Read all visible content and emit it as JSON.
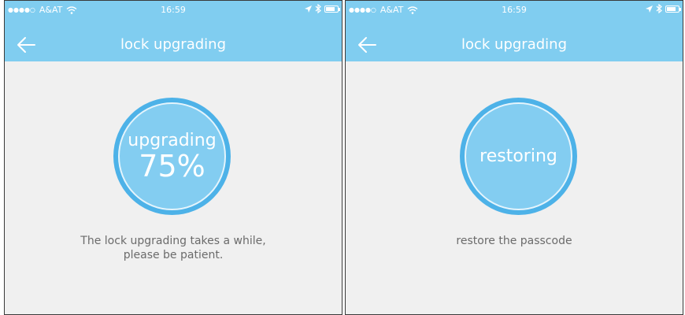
{
  "status_bar": {
    "carrier": "A&AT",
    "time": "16:59"
  },
  "screens": [
    {
      "title": "lock upgrading",
      "progress_label": "upgrading",
      "progress_value": "75%",
      "message_line1": "The lock upgrading takes a while,",
      "message_line2": "please be patient."
    },
    {
      "title": "lock upgrading",
      "progress_label": "restoring",
      "message_line1": "restore the passcode"
    }
  ],
  "colors": {
    "header": "#80cdf0",
    "ring": "#4db2e8",
    "disc": "#83cdf1",
    "background": "#f0f0f0",
    "message_text": "#6b6b6b"
  },
  "icons": [
    "back-arrow-icon",
    "wifi-icon",
    "location-arrow-icon",
    "bluetooth-icon",
    "battery-icon"
  ]
}
